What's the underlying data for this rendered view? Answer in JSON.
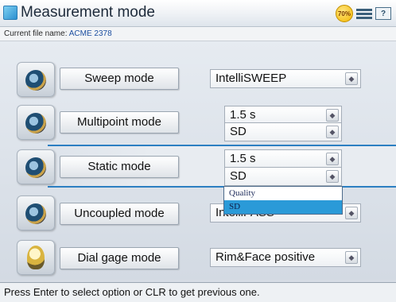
{
  "window": {
    "title": "Measurement mode"
  },
  "status": {
    "battery": "70%",
    "help_label": "?"
  },
  "file": {
    "label": "Current file name:",
    "name": "ACME 2378"
  },
  "modes": [
    {
      "label": "Sweep mode",
      "value": "IntelliSWEEP"
    },
    {
      "label": "Multipoint mode",
      "value1": "1.5 s",
      "value2": "SD"
    },
    {
      "label": "Static mode",
      "value1": "1.5 s",
      "value2": "SD"
    },
    {
      "label": "Uncoupled mode",
      "value": "IntelliPASS"
    },
    {
      "label": "Dial gage mode",
      "value": "Rim&Face positive"
    }
  ],
  "dropdown": {
    "options": [
      "Quality",
      "SD"
    ],
    "selected": "SD"
  },
  "statusbar": {
    "text": "Press Enter to select option or CLR to get previous one."
  }
}
